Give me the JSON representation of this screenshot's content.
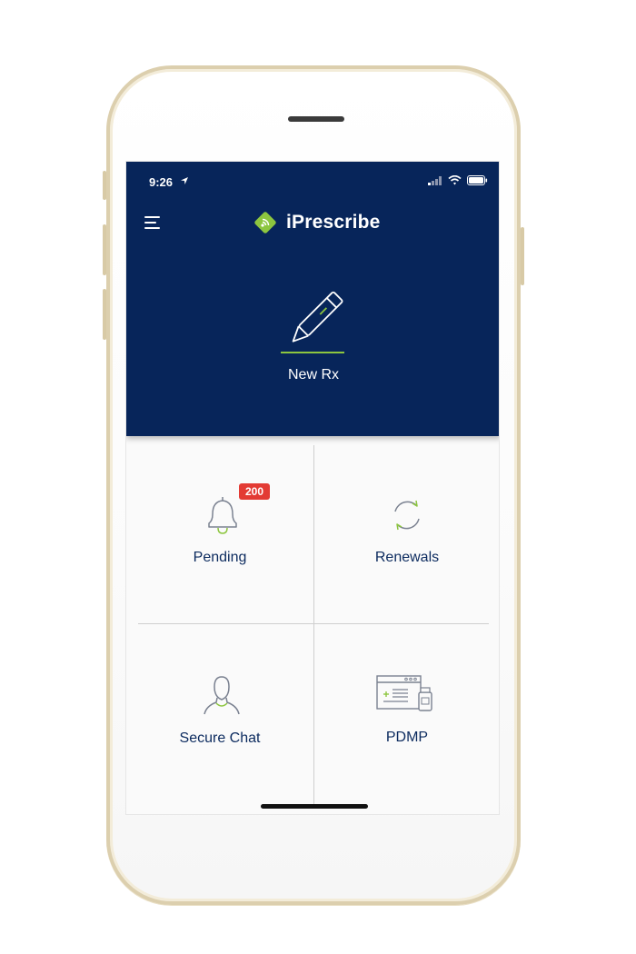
{
  "status_bar": {
    "time": "9:26"
  },
  "header": {
    "brand_name": "iPrescribe",
    "primary_action_label": "New Rx"
  },
  "tiles": [
    {
      "label": "Pending",
      "icon": "bell-icon",
      "badge": "200"
    },
    {
      "label": "Renewals",
      "icon": "refresh-icon"
    },
    {
      "label": "Secure Chat",
      "icon": "person-icon"
    },
    {
      "label": "PDMP",
      "icon": "pdmp-monitor-icon"
    }
  ],
  "colors": {
    "header_bg": "#07255a",
    "accent_green": "#8dc63f",
    "badge_red": "#e33b34",
    "label_navy": "#0b2a5e"
  }
}
